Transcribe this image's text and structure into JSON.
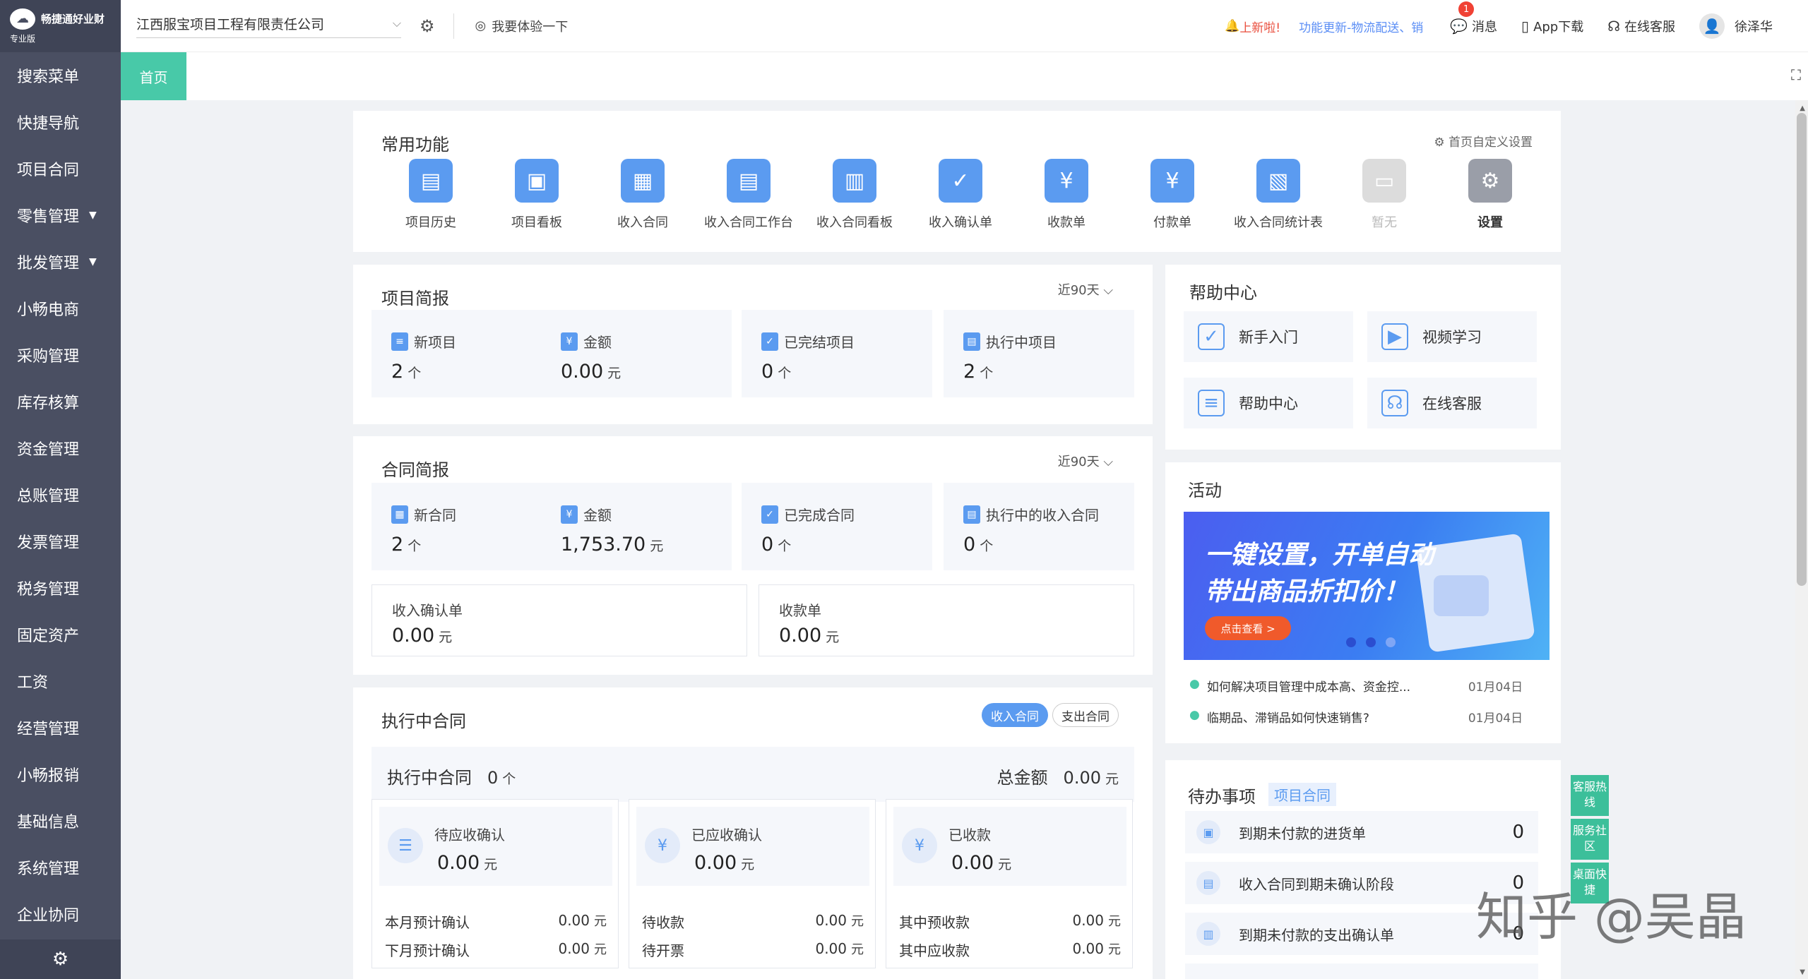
{
  "sidebar": {
    "brand": "畅捷通好业财",
    "edition": "专业版",
    "logo_icon": "cloud-logo",
    "items": [
      "搜索菜单",
      "快捷导航",
      "项目合同",
      "零售管理",
      "批发管理",
      "小畅电商",
      "采购管理",
      "库存核算",
      "资金管理",
      "总账管理",
      "发票管理",
      "税务管理",
      "固定资产",
      "工资",
      "经营管理",
      "小畅报销",
      "基础信息",
      "系统管理",
      "企业协同"
    ],
    "footer_icon": "gear-icon"
  },
  "topbar": {
    "company": "江西服宝项目工程有限责任公司",
    "trial": "我要体验一下",
    "notice_label": "上新啦!",
    "notice_text": "功能更新-物流配送、销",
    "message": "消息",
    "message_badge": "1",
    "app_download": "App下载",
    "online_service": "在线客服",
    "user": "徐泽华"
  },
  "tabs": {
    "active": "首页"
  },
  "common_functions": {
    "title": "常用功能",
    "custom_link": "首页自定义设置",
    "items": [
      {
        "label": "项目历史",
        "icon": "list-icon"
      },
      {
        "label": "项目看板",
        "icon": "board-icon"
      },
      {
        "label": "收入合同",
        "icon": "contract-icon"
      },
      {
        "label": "收入合同工作台",
        "icon": "workbench-icon"
      },
      {
        "label": "收入合同看板",
        "icon": "board-icon"
      },
      {
        "label": "收入确认单",
        "icon": "confirm-icon"
      },
      {
        "label": "收款单",
        "icon": "receipt-icon"
      },
      {
        "label": "付款单",
        "icon": "payment-icon"
      },
      {
        "label": "收入合同统计表",
        "icon": "stats-icon"
      },
      {
        "label": "暂无",
        "icon": "empty-icon"
      },
      {
        "label": "设置",
        "icon": "gear-icon"
      }
    ]
  },
  "project_brief": {
    "title": "项目简报",
    "range": "近90天",
    "stats": [
      {
        "label": "新项目",
        "value": "2",
        "unit": "个"
      },
      {
        "label": "金额",
        "value": "0.00",
        "unit": "元"
      },
      {
        "label": "已完结项目",
        "value": "0",
        "unit": "个"
      },
      {
        "label": "执行中项目",
        "value": "2",
        "unit": "个"
      }
    ]
  },
  "contract_brief": {
    "title": "合同简报",
    "range": "近90天",
    "stats": [
      {
        "label": "新合同",
        "value": "2",
        "unit": "个"
      },
      {
        "label": "金额",
        "value": "1,753.70",
        "unit": "元"
      },
      {
        "label": "已完成合同",
        "value": "0",
        "unit": "个"
      },
      {
        "label": "执行中的收入合同",
        "value": "0",
        "unit": "个"
      }
    ],
    "extra": [
      {
        "label": "收入确认单",
        "value": "0.00",
        "unit": "元"
      },
      {
        "label": "收款单",
        "value": "0.00",
        "unit": "元"
      }
    ]
  },
  "executing": {
    "title": "执行中合同",
    "tab_income": "收入合同",
    "tab_expense": "支出合同",
    "count_label": "执行中合同",
    "count_value": "0",
    "count_unit": "个",
    "total_label": "总金额",
    "total_value": "0.00",
    "total_unit": "元",
    "columns": [
      {
        "name": "待应收确认",
        "amount": "0.00",
        "unit": "元",
        "rows": [
          {
            "k": "本月预计确认",
            "v": "0.00"
          },
          {
            "k": "下月预计确认",
            "v": "0.00"
          }
        ]
      },
      {
        "name": "已应收确认",
        "amount": "0.00",
        "unit": "元",
        "rows": [
          {
            "k": "待收款",
            "v": "0.00"
          },
          {
            "k": "待开票",
            "v": "0.00"
          }
        ]
      },
      {
        "name": "已收款",
        "amount": "0.00",
        "unit": "元",
        "rows": [
          {
            "k": "其中预收款",
            "v": "0.00"
          },
          {
            "k": "其中应收款",
            "v": "0.00"
          }
        ]
      }
    ]
  },
  "help_center": {
    "title": "帮助中心",
    "items": [
      {
        "label": "新手入门",
        "icon": "clipboard-icon"
      },
      {
        "label": "视频学习",
        "icon": "video-icon"
      },
      {
        "label": "帮助中心",
        "icon": "document-icon"
      },
      {
        "label": "在线客服",
        "icon": "headset-icon"
      }
    ]
  },
  "activity": {
    "title": "活动",
    "banner_line1": "一键设置，开单自动",
    "banner_line2": "带出商品折扣价！",
    "banner_button": "点击查看 >",
    "news": [
      {
        "title": "如何解决项目管理中成本高、资金控...",
        "date": "01月04日"
      },
      {
        "title": "临期品、滞销品如何快速销售?",
        "date": "01月04日"
      }
    ]
  },
  "todo": {
    "title": "待办事项",
    "tag": "项目合同",
    "items": [
      {
        "label": "到期未付款的进货单",
        "count": "0"
      },
      {
        "label": "收入合同到期未确认阶段",
        "count": "0"
      },
      {
        "label": "到期未付款的支出确认单",
        "count": "0"
      }
    ]
  },
  "float_bar": [
    "客服热线",
    "服务社区",
    "桌面快捷"
  ],
  "watermark": "知乎 @吴晶",
  "colors": {
    "sidebar": "#4a4f62",
    "accent": "#48c9a8",
    "primary": "#5b9bf0"
  }
}
